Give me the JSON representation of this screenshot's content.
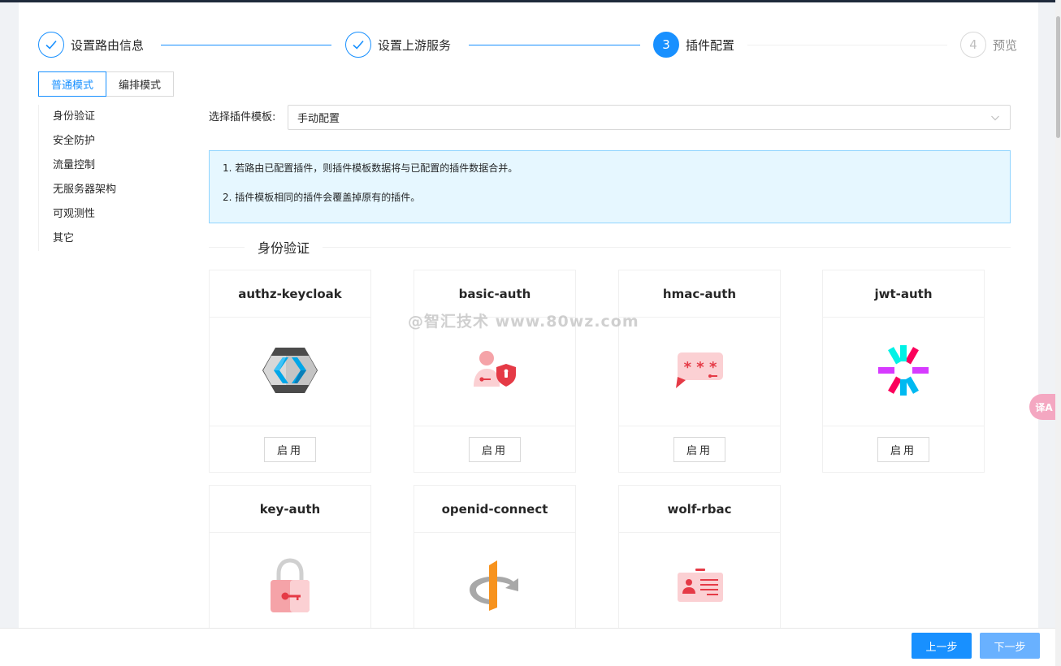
{
  "steps": [
    {
      "index": "1",
      "title": "设置路由信息",
      "status": "finish"
    },
    {
      "index": "2",
      "title": "设置上游服务",
      "status": "finish"
    },
    {
      "index": "3",
      "title": "插件配置",
      "status": "process"
    },
    {
      "index": "4",
      "title": "预览",
      "status": "wait"
    }
  ],
  "mode_tabs": {
    "normal": "普通模式",
    "orchestration": "编排模式"
  },
  "side_menu": [
    "身份验证",
    "安全防护",
    "流量控制",
    "无服务器架构",
    "可观测性",
    "其它"
  ],
  "template": {
    "label": "选择插件模板:",
    "value": "手动配置"
  },
  "alert": {
    "line1": "1. 若路由已配置插件，则插件模板数据将与已配置的插件数据合并。",
    "line2": "2. 插件模板相同的插件会覆盖掉原有的插件。"
  },
  "section": {
    "title": "身份验证"
  },
  "plugins": [
    {
      "name": "authz-keycloak",
      "icon": "keycloak-icon",
      "action": "启用"
    },
    {
      "name": "basic-auth",
      "icon": "user-shield-icon",
      "action": "启用"
    },
    {
      "name": "hmac-auth",
      "icon": "password-bubble-icon",
      "action": "启用"
    },
    {
      "name": "jwt-auth",
      "icon": "jwt-icon",
      "action": "启用"
    },
    {
      "name": "key-auth",
      "icon": "padlock-icon",
      "action": ""
    },
    {
      "name": "openid-connect",
      "icon": "openid-icon",
      "action": ""
    },
    {
      "name": "wolf-rbac",
      "icon": "id-card-icon",
      "action": ""
    }
  ],
  "watermark": "@智汇技术 www.80wz.com",
  "translate_badge": "译A",
  "footer": {
    "prev": "上一步",
    "next": "下一步"
  },
  "colors": {
    "primary": "#1890ff",
    "alert_bg": "#e6f7ff",
    "icon_pink": "#f5a3a8",
    "icon_red": "#e53a46"
  }
}
